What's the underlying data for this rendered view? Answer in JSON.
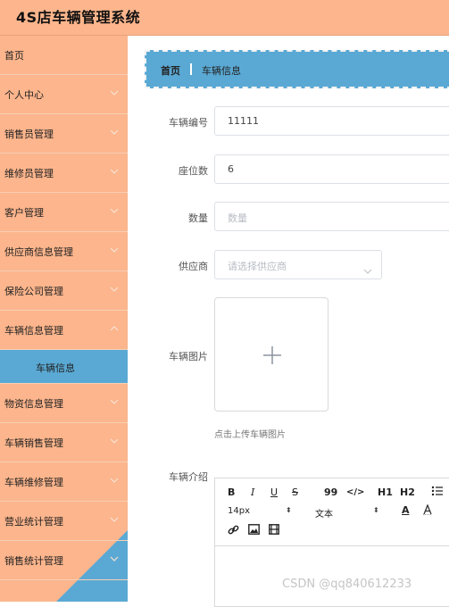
{
  "app": {
    "title": "4S店车辆管理系统"
  },
  "sidebar": {
    "items": [
      {
        "label": "首页",
        "has_chevron": false
      },
      {
        "label": "个人中心",
        "has_chevron": true
      },
      {
        "label": "销售员管理",
        "has_chevron": true
      },
      {
        "label": "维修员管理",
        "has_chevron": true
      },
      {
        "label": "客户管理",
        "has_chevron": true
      },
      {
        "label": "供应商信息管理",
        "has_chevron": true
      },
      {
        "label": "保险公司管理",
        "has_chevron": true
      },
      {
        "label": "车辆信息管理",
        "has_chevron": true,
        "expanded": true
      },
      {
        "label": "车辆信息",
        "is_submenu": true,
        "active": true
      },
      {
        "label": "物资信息管理",
        "has_chevron": true
      },
      {
        "label": "车辆销售管理",
        "has_chevron": true
      },
      {
        "label": "车辆维修管理",
        "has_chevron": true
      },
      {
        "label": "营业统计管理",
        "has_chevron": true
      },
      {
        "label": "销售统计管理",
        "has_chevron": true
      }
    ]
  },
  "breadcrumb": {
    "home": "首页",
    "current": "车辆信息"
  },
  "form": {
    "vehicle_no": {
      "label": "车辆编号",
      "value": "11111"
    },
    "seats": {
      "label": "座位数",
      "value": "6"
    },
    "quantity": {
      "label": "数量",
      "placeholder": "数量"
    },
    "supplier": {
      "label": "供应商",
      "placeholder": "请选择供应商"
    },
    "image": {
      "label": "车辆图片",
      "tip": "点击上传车辆图片"
    },
    "intro": {
      "label": "车辆介绍"
    }
  },
  "editor": {
    "toolbar": {
      "bold": "B",
      "italic": "I",
      "underline": "U",
      "strike": "S",
      "quote": "99",
      "code": "</>",
      "h1": "H1",
      "h2": "H2",
      "font_size": "14px",
      "font_type": "文本",
      "font_color": "A"
    }
  },
  "watermark": "CSDN @qq840612233",
  "colors": {
    "sidebar": "#fcb58c",
    "accent": "#5aa9d4"
  }
}
